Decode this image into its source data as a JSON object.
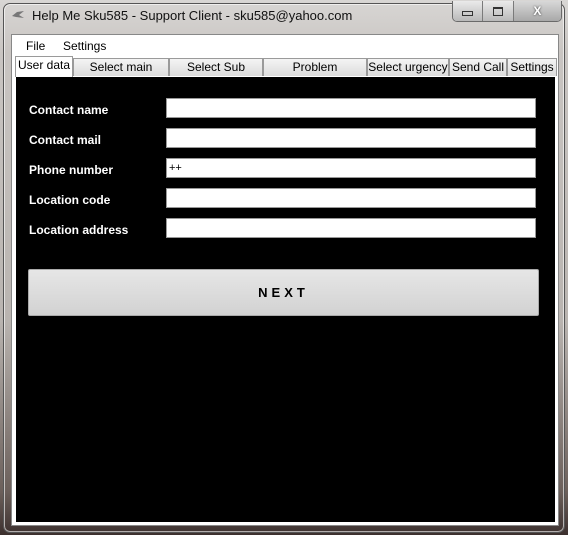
{
  "window": {
    "title": "Help Me Sku585 - Support Client - sku585@yahoo.com",
    "minimize": "▭",
    "maximize": "▢",
    "close": "X"
  },
  "menu": [
    {
      "label": "File"
    },
    {
      "label": "Settings"
    }
  ],
  "tabs": [
    {
      "label": "User data",
      "active": true
    },
    {
      "label": "Select main group"
    },
    {
      "label": "Select Sub group"
    },
    {
      "label": "Problem description"
    },
    {
      "label": "Select urgency"
    },
    {
      "label": "Send Call"
    },
    {
      "label": "Settings"
    }
  ],
  "form": {
    "fields": [
      {
        "label": "Contact name",
        "value": ""
      },
      {
        "label": "Contact mail",
        "value": ""
      },
      {
        "label": "Phone number",
        "value": "++"
      },
      {
        "label": "Location code",
        "value": ""
      },
      {
        "label": "Location address",
        "value": ""
      }
    ],
    "next_label": "NEXT"
  }
}
